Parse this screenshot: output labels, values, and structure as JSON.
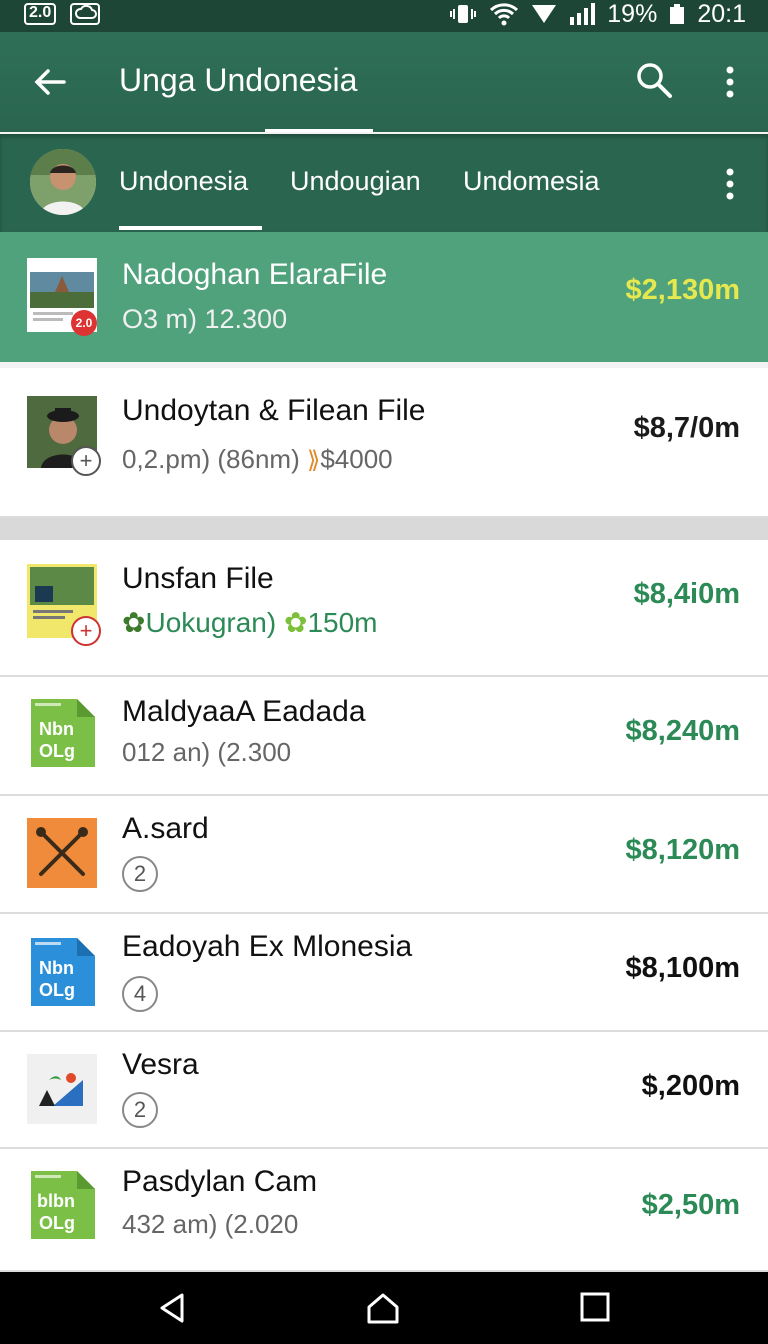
{
  "status": {
    "left_badge": "2.0",
    "battery": "19%",
    "time": "20:1"
  },
  "appbar": {
    "title": "Unga Undonesia"
  },
  "tabs": [
    {
      "label": "Undonesia"
    },
    {
      "label": "Undougian"
    },
    {
      "label": "Undomesia"
    }
  ],
  "rows": [
    {
      "title": "Nadoghan ElaraFile",
      "sub": "O3 m) 12.300",
      "price": "$2,130m",
      "price_color": "#e5e84f",
      "badge": "2.0"
    },
    {
      "title": "Undoytan & Filean File",
      "sub": "0,2.pm) (86nm)",
      "sub_extra": "$4000",
      "price": "$8,7/0m",
      "price_color": "#1b1b1b"
    },
    {
      "title": "Unsfan File",
      "sub": "Uokugran)",
      "sub_extra": "150m",
      "price": "$8,4i0m",
      "price_color": "#2b8a55"
    },
    {
      "title": "MaldyaaA Eadada",
      "sub": "012 an) (2.300",
      "price": "$8,240m",
      "price_color": "#2b8a55",
      "icon_text": "Nbn\nOLg"
    },
    {
      "title": "A.sard",
      "circle": "2",
      "price": "$8,120m",
      "price_color": "#2b8a55"
    },
    {
      "title": "Eadoyah Ex Mlonesia",
      "circle": "4",
      "price": "$8,100m",
      "price_color": "#111111",
      "icon_text": "Nbn\nOLg"
    },
    {
      "title": "Vesra",
      "circle": "2",
      "price": "$,200m",
      "price_color": "#111111"
    },
    {
      "title": "Pasdylan Cam",
      "sub": "432 am) (2.020",
      "price": "$2,50m",
      "price_color": "#2b8a55",
      "icon_text": "blbn\nOLg"
    }
  ],
  "icons": [
    "back-arrow-icon",
    "search-icon",
    "more-vert-icon",
    "back-nav-icon",
    "home-nav-icon",
    "recents-nav-icon"
  ]
}
